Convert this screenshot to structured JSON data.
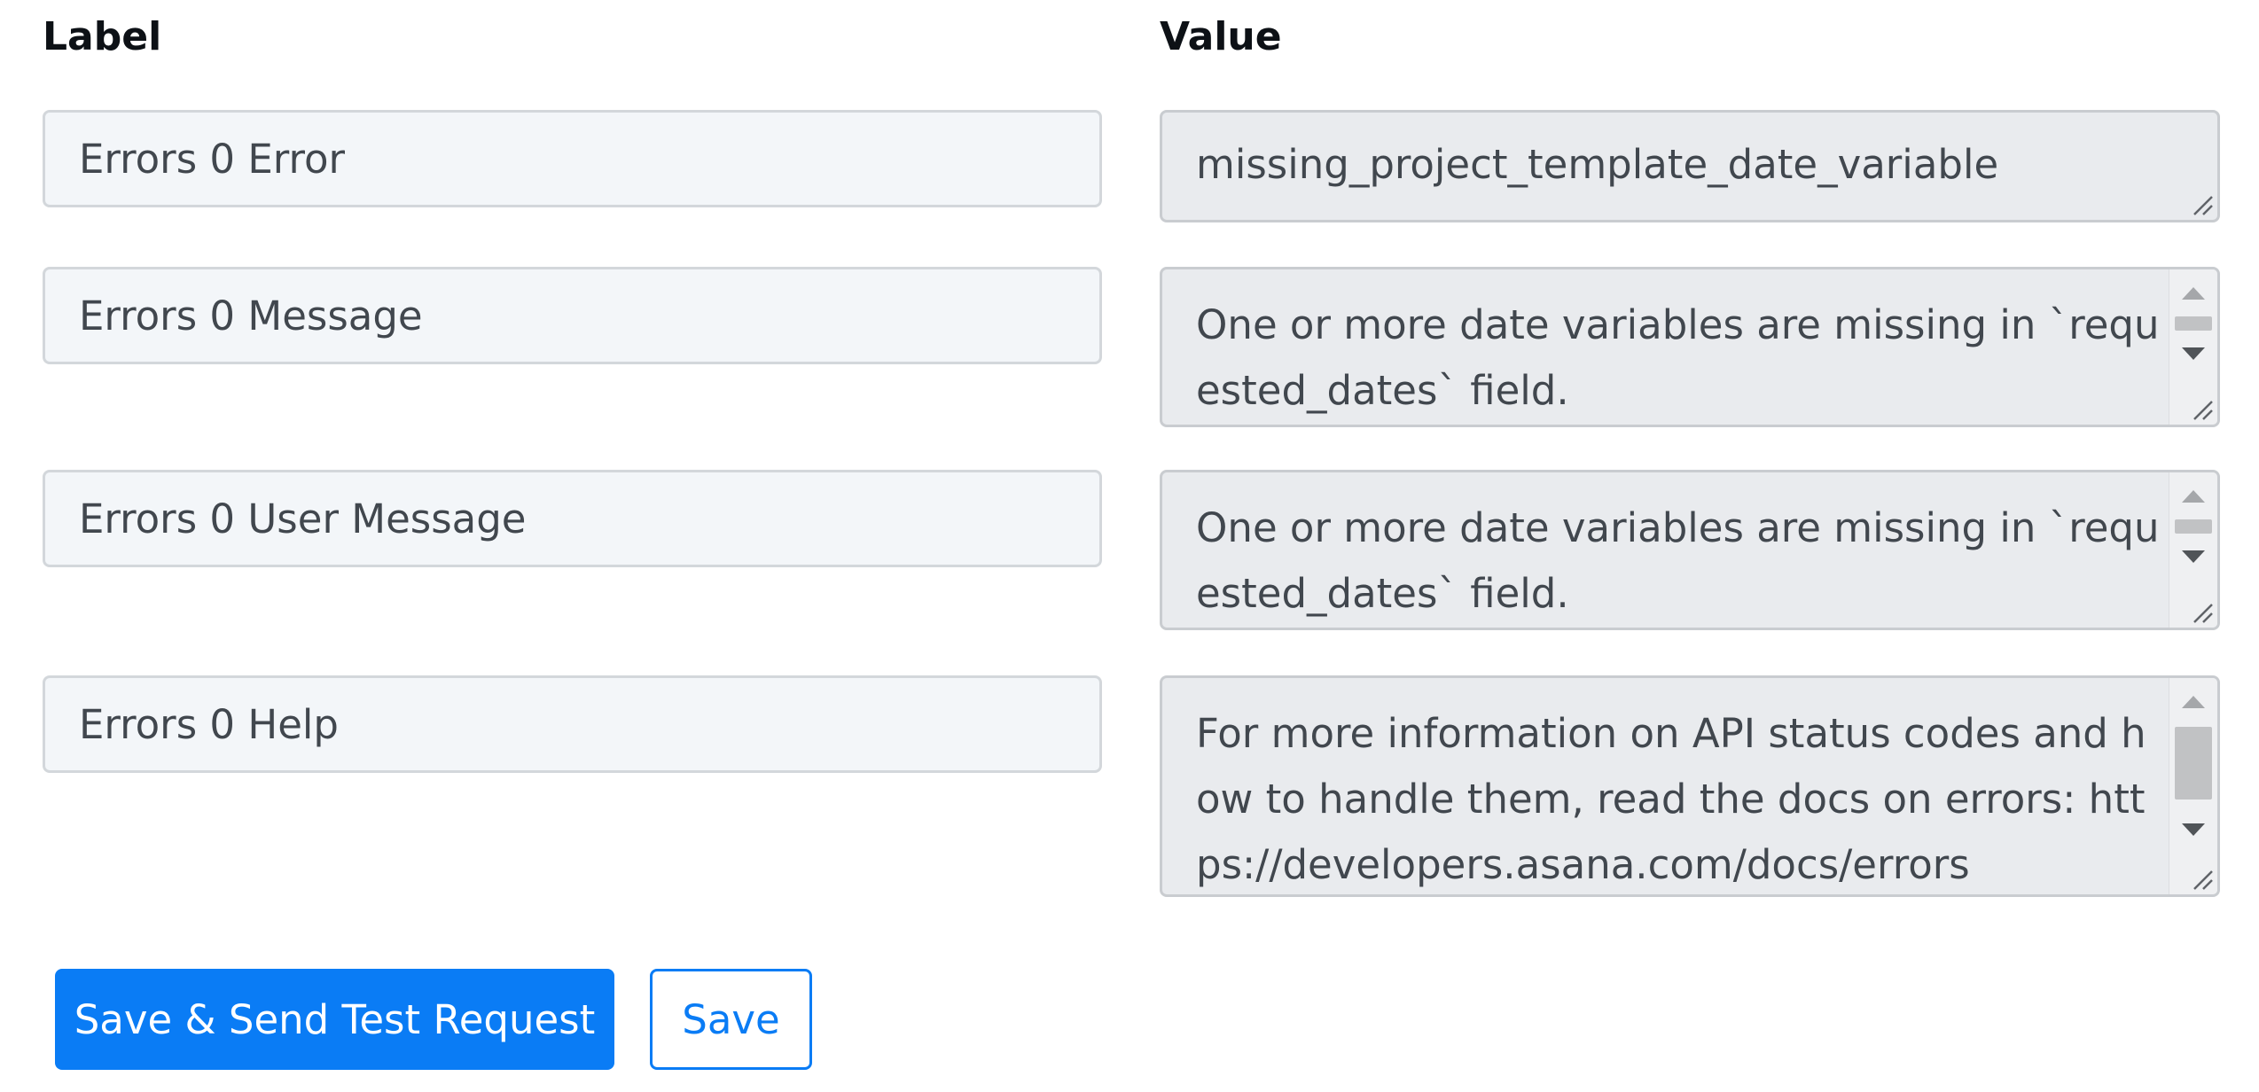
{
  "headers": {
    "label": "Label",
    "value": "Value"
  },
  "rows": [
    {
      "label": "Errors 0 Error",
      "value": "missing_project_template_date_variable"
    },
    {
      "label": "Errors 0 Message",
      "value": "One or more date variables are missing in `requested_dates` field."
    },
    {
      "label": "Errors 0 User Message",
      "value": "One or more date variables are missing in `requested_dates` field."
    },
    {
      "label": "Errors 0 Help",
      "value": "For more information on API status codes and how to handle them, read the docs on errors: https://developers.asana.com/docs/errors"
    }
  ],
  "actions": {
    "save_and_send_label": "Save & Send Test Request",
    "save_label": "Save"
  },
  "colors": {
    "primary": "#0a7cf5",
    "input_bg": "#f3f6f9",
    "readonly_bg": "#e9ebee",
    "border": "#d3d7db"
  },
  "icons": {
    "resize": "resize-grip-icon",
    "scroll_up": "scroll-up-arrow-icon",
    "scroll_down": "scroll-down-arrow-icon"
  }
}
